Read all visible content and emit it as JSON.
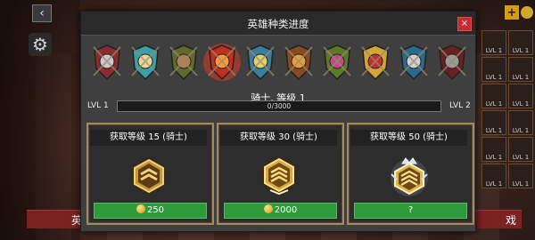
{
  "background": {
    "back_icon": "chevron-left-icon",
    "gear_icon": "gear-icon",
    "plus_label": "+",
    "card_level_label": "LVL 1",
    "banner_left_text": "英",
    "banner_right_text": "戏"
  },
  "modal": {
    "title": "英雄种类进度",
    "close_label": "×",
    "hero_classes": [
      {
        "name": "knight-icon",
        "selected": false
      },
      {
        "name": "scholar-icon",
        "selected": false
      },
      {
        "name": "ranger-icon",
        "selected": false
      },
      {
        "name": "berserker-icon",
        "selected": true
      },
      {
        "name": "guardian-icon",
        "selected": false
      },
      {
        "name": "beast-icon",
        "selected": false
      },
      {
        "name": "alchemist-icon",
        "selected": false
      },
      {
        "name": "paladin-icon",
        "selected": false
      },
      {
        "name": "warden-icon",
        "selected": false
      },
      {
        "name": "warlord-icon",
        "selected": false
      }
    ],
    "hero_name": "骑士, 等级 1",
    "level_current": "LVL 1",
    "level_next": "LVL 2",
    "xp_text": "0/3000",
    "xp_fraction": 0,
    "rewards": [
      {
        "title": "获取等级 15 (骑士)",
        "price": "250",
        "emblem": "bronze-rank-emblem-icon"
      },
      {
        "title": "获取等级 30 (骑士)",
        "price": "2000",
        "emblem": "gold-rank-emblem-icon"
      },
      {
        "title": "获取等级 50 (骑士)",
        "price": "?",
        "emblem": "crowned-rank-emblem-icon"
      }
    ]
  },
  "colors": {
    "accent_green": "#2f9a3c",
    "close_red": "#c62b33",
    "card_border": "#a8895a",
    "xp_fill": "#5aa0d8"
  }
}
